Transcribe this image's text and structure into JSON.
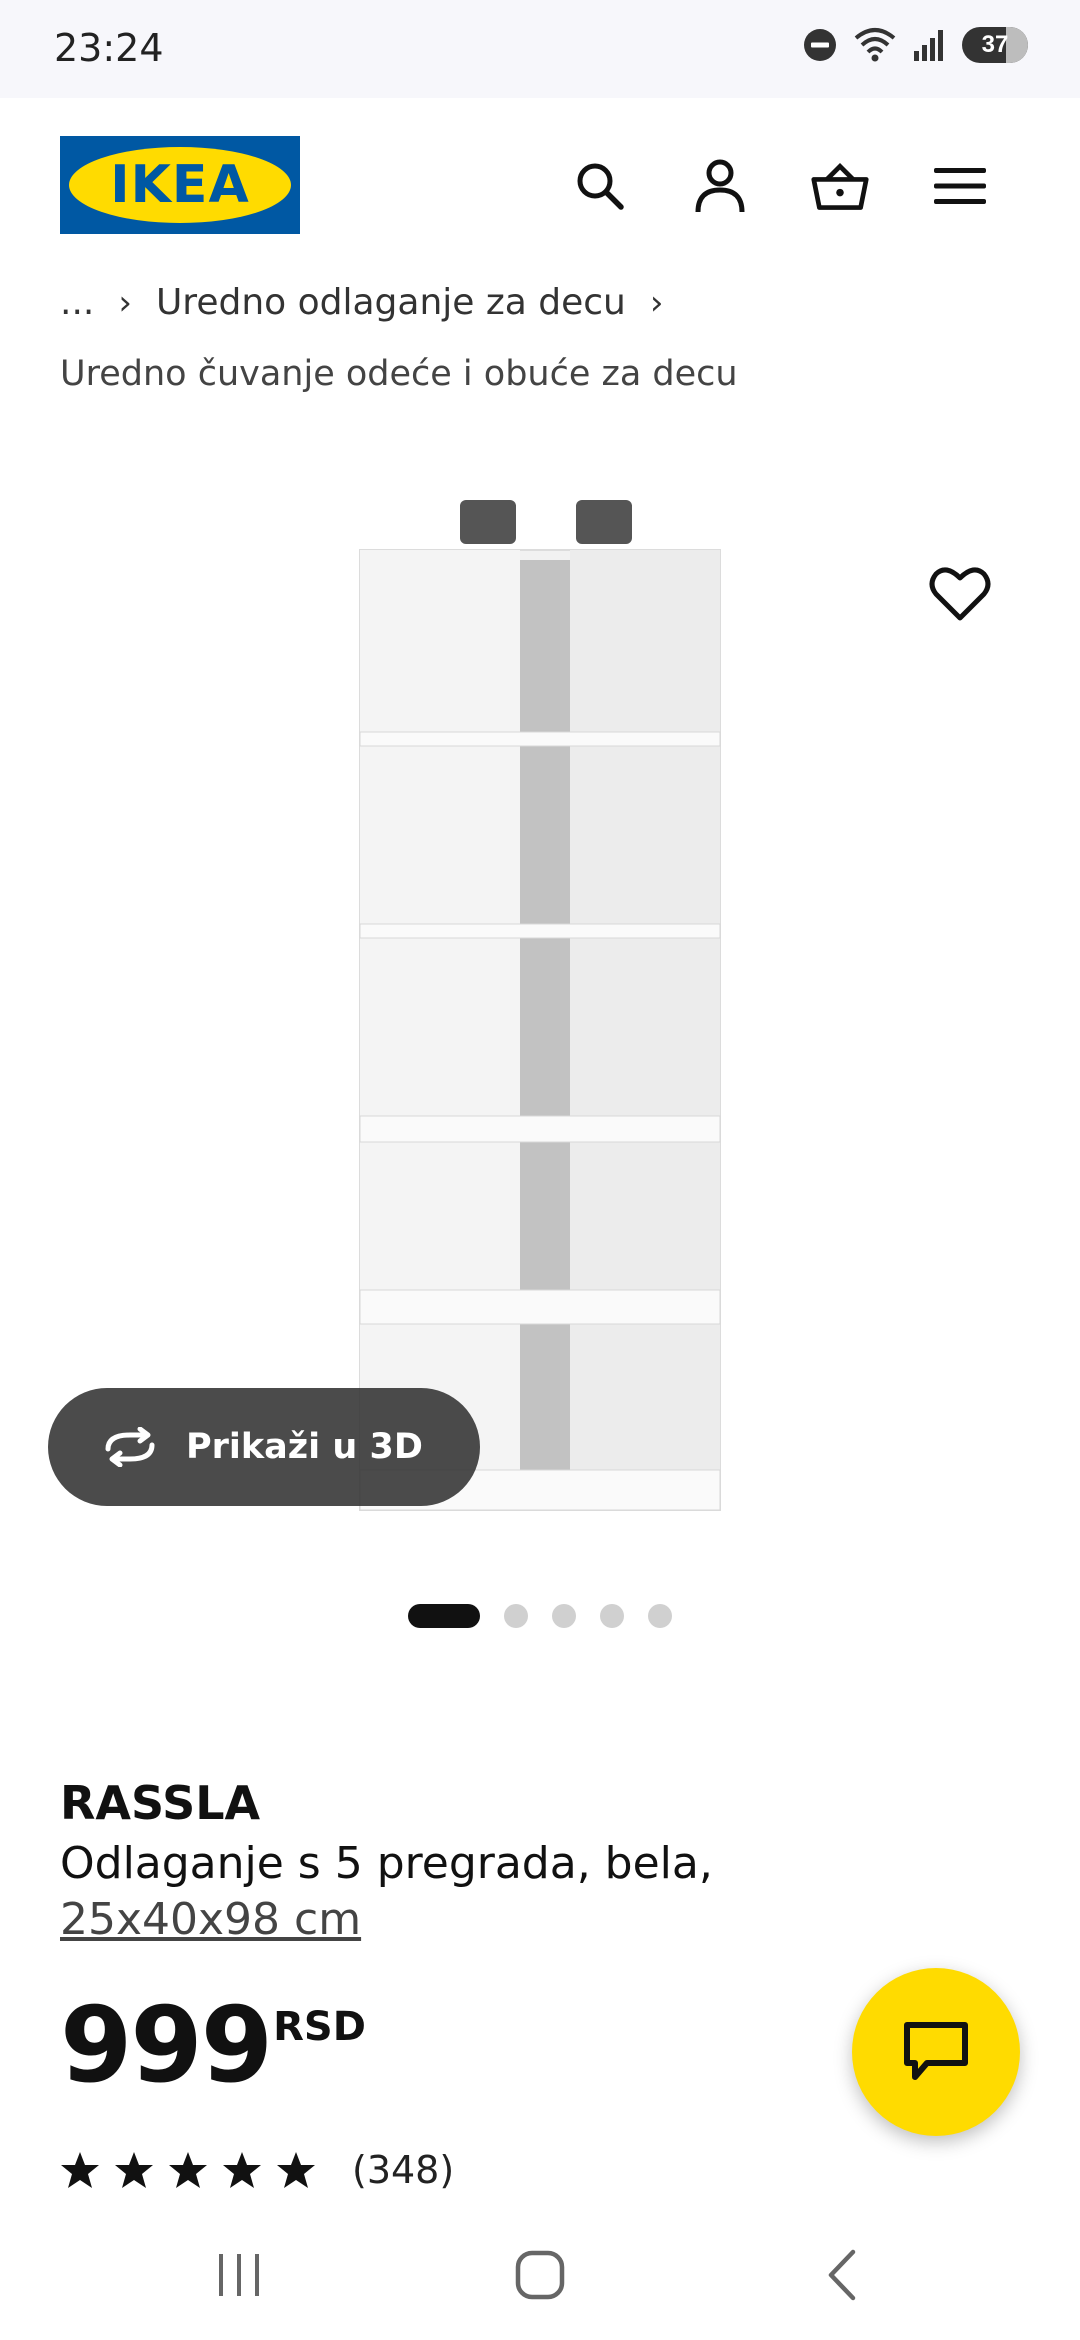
{
  "status_bar": {
    "time": "23:24",
    "battery": "37",
    "icons": [
      "do-not-disturb-icon",
      "wifi-icon",
      "signal-icon",
      "battery-icon"
    ]
  },
  "header": {
    "logo_text": "IKEA",
    "icons": [
      "search-icon",
      "account-icon",
      "basket-icon",
      "menu-icon"
    ],
    "brand_colors": {
      "blue": "#0058a3",
      "yellow": "#ffdb00"
    }
  },
  "breadcrumb": {
    "ellipsis": "...",
    "item": "Uredno odlaganje za decu",
    "subcategory": "Uredno čuvanje odeće i obuće za decu"
  },
  "gallery": {
    "view_3d_label": "Prikaži u 3D",
    "dots_total": 5,
    "active_dot": 1
  },
  "product": {
    "name": "RASSLA",
    "description": "Odlaganje s 5 pregrada, bela,",
    "dimensions": "25x40x98 cm",
    "price": "999",
    "currency": "RSD",
    "rating_stars": 5,
    "rating_count": "(348)"
  },
  "nav": {
    "icons": [
      "recent-apps-icon",
      "home-icon",
      "back-icon"
    ]
  }
}
